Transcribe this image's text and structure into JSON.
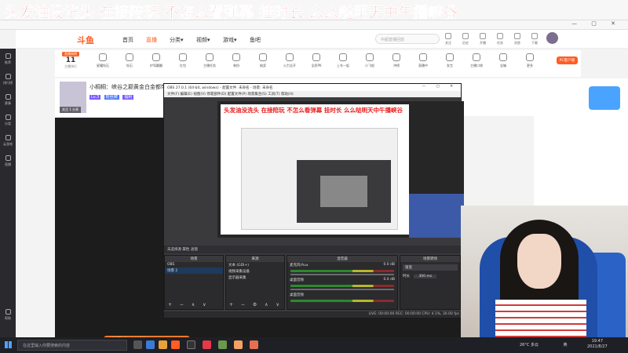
{
  "banner": {
    "text": "头发油没洗头 在接陪玩 不怎么看弹幕 挂时长 么么哒明天中午播峡谷"
  },
  "browser": {
    "url": "www.douyu.com/..."
  },
  "nav": {
    "logo": "斗鱼",
    "items": [
      "首页",
      "直播",
      "分类▾",
      "视频▾",
      "游戏▾",
      "鱼吧"
    ],
    "search_placeholder": "中超直播回放",
    "icons": [
      "关注",
      "历史",
      "开播",
      "任务",
      "消息",
      "下载"
    ]
  },
  "sidebar": {
    "items": [
      "推荐",
      "排行榜",
      "赛事",
      "分类",
      "云游戏",
      "直播",
      "帮助"
    ]
  },
  "categories": {
    "rank_tag": "直播周榜",
    "rank_num": "11",
    "rank_sub": "主播排行",
    "items": [
      "星耀钻石",
      "钻石",
      "护驾翻翻",
      "红包",
      "主播任务",
      "装扮",
      "抽奖",
      "火力全开",
      "全民PK",
      "上车一起",
      "小飞船",
      "冲榜",
      "直播中",
      "发言",
      "主播口袋",
      "宝箱",
      "更多"
    ],
    "promo": "PC客户端"
  },
  "streamer": {
    "name": "小桐桐：峡谷之巅黄金白金都带",
    "level": "Lv.3",
    "tags": [
      "LV",
      "粉丝牌",
      "福利"
    ],
    "fans": "关注 1 分享"
  },
  "obs": {
    "title": "OBS 27.0.1 (64-bit, windows) - 配置文件: 未命名 - 场景: 未命名",
    "menu": "文件(F)  编辑(E)  视图(V)  停靠部件(D)  配置文件(P)  场景集合(S)  工具(T)  帮助(H)",
    "preview_banner": "头发油没洗头 在接陪玩 不怎么看弹幕 挂时长 么么哒明天中午播峡谷",
    "source_bar": "未选择源    属性    滤镜",
    "docks": {
      "scenes": {
        "title": "场景",
        "rows": [
          "OBS",
          "场景 2"
        ]
      },
      "sources": {
        "title": "来源",
        "rows": [
          "文本 (GDI+)",
          "视频采集设备",
          "显示器采集"
        ]
      },
      "mixer": {
        "title": "混音器",
        "tracks": [
          {
            "name": "麦克风/Aux",
            "db": "0.0 dB"
          },
          {
            "name": "桌面音频",
            "db": "0.0 dB"
          },
          {
            "name": "桌面音频",
            "db": ""
          }
        ]
      },
      "transitions": {
        "title": "场景转场",
        "type": "渐变",
        "duration_label": "时长",
        "duration": "300 ms"
      }
    },
    "status": "LIVE: 00:00:00    REC: 00:00:00    CPU: 4.1%, 30.00 fps"
  },
  "taskbar": {
    "search": "在这里输入你要搜索的内容",
    "weather": "26°C 多云",
    "lang": "英",
    "time": "19:47",
    "date": "2021/8/27",
    "promo": "主播招募计划，点击立即参与"
  },
  "colors": {
    "banner_red": "#e62020",
    "accent": "#ff5d23",
    "obs_bg": "#3a3a3d"
  }
}
